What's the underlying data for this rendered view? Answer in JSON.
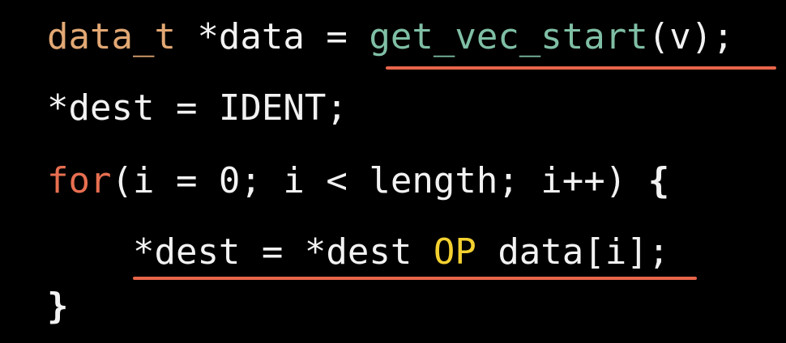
{
  "code": {
    "line1": {
      "type": "data_t",
      "rest": " *data = ",
      "func": "get_vec_start",
      "args": "(v);"
    },
    "line2": {
      "text": "*dest = IDENT;"
    },
    "line3": {
      "keyword": "for",
      "rest": "(i = 0; i < length; i++) ",
      "brace": "{"
    },
    "line4": {
      "indent": "    ",
      "lhs": "*dest = *dest ",
      "macro": "OP",
      "rhs": " data[i];"
    },
    "line5": {
      "brace": "}"
    }
  },
  "colors": {
    "background": "#000000",
    "text": "#f2f2f2",
    "type": "#e2a874",
    "function": "#7fbfa5",
    "keyword": "#e76f51",
    "macro": "#f4d130",
    "underline": "#e8654a"
  }
}
